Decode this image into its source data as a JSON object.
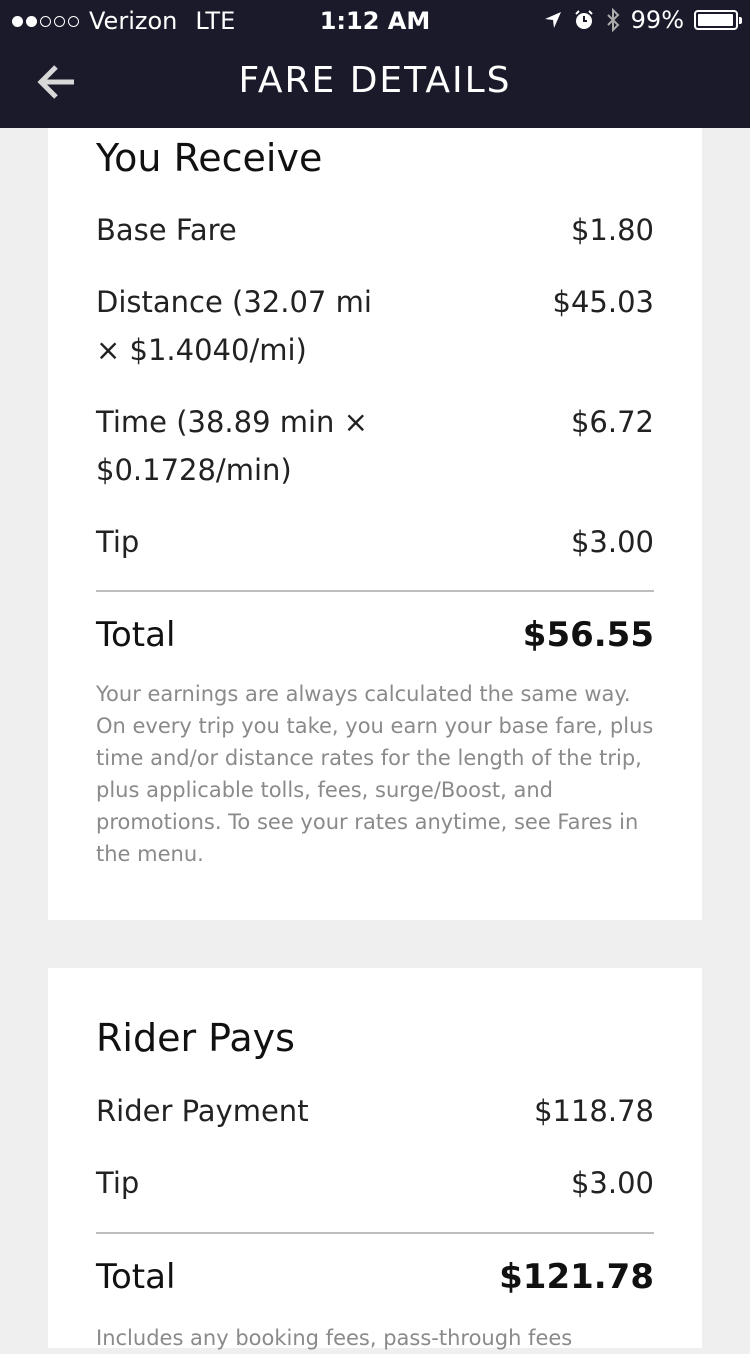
{
  "status_bar": {
    "carrier": "Verizon",
    "network": "LTE",
    "time": "1:12 AM",
    "battery": "99%",
    "signal_bars_filled": 2,
    "signal_bars_total": 5
  },
  "header": {
    "title": "FARE DETAILS"
  },
  "you_receive": {
    "heading": "You Receive",
    "items": [
      {
        "label": "Base Fare",
        "value": "$1.80"
      },
      {
        "label": "Distance (32.07 mi × $1.4040/mi)",
        "value": "$45.03"
      },
      {
        "label": "Time (38.89 min × $0.1728/min)",
        "value": "$6.72"
      },
      {
        "label": "Tip",
        "value": "$3.00"
      }
    ],
    "total_label": "Total",
    "total_value": "$56.55",
    "note": "Your earnings are always calculated the same way. On every trip you take, you earn your base fare, plus time and/or distance rates for the length of the trip, plus applicable tolls, fees, surge/Boost, and promotions. To see your rates anytime, see Fares in the menu."
  },
  "rider_pays": {
    "heading": "Rider Pays",
    "items": [
      {
        "label": "Rider Payment",
        "value": "$118.78"
      },
      {
        "label": "Tip",
        "value": "$3.00"
      }
    ],
    "total_label": "Total",
    "total_value": "$121.78",
    "note": "Includes any booking fees, pass-through fees"
  }
}
